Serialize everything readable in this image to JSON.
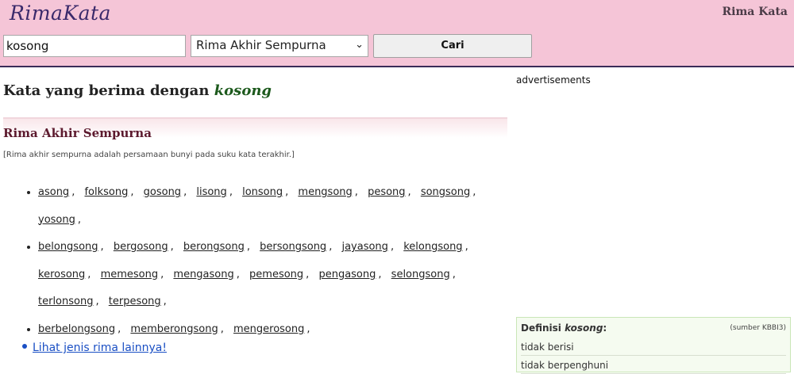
{
  "header": {
    "logo": "RimaKata",
    "site_name": "Rima Kata",
    "search_value": "kosong",
    "select_value": "Rima Akhir Sempurna",
    "search_button": "Cari"
  },
  "main": {
    "title_prefix": "Kata yang berima dengan",
    "title_word": "kosong",
    "section_title": "Rima Akhir Sempurna",
    "description": "[Rima akhir sempurna adalah persamaan bunyi pada suku kata terakhir.]",
    "groups": [
      [
        "asong",
        "folksong",
        "gosong",
        "lisong",
        "lonsong",
        "mengsong",
        "pesong",
        "songsong",
        "yosong"
      ],
      [
        "belongsong",
        "bergosong",
        "berongsong",
        "bersongsong",
        "jayasong",
        "kelongsong",
        "kerosong",
        "memesong",
        "mengasong",
        "pemesong",
        "pengasong",
        "selongsong",
        "terlonsong",
        "terpesong"
      ],
      [
        "berbelongsong",
        "memberongsong",
        "mengerosong"
      ]
    ],
    "more_link": "Lihat jenis rima lainnya!"
  },
  "sidebar": {
    "ads_label": "advertisements",
    "definition": {
      "label": "Definisi",
      "word": "kosong",
      "colon": ":",
      "source": "(sumber KBBI3)",
      "lines": [
        "tidak berisi",
        "tidak berpenghuni"
      ]
    }
  }
}
